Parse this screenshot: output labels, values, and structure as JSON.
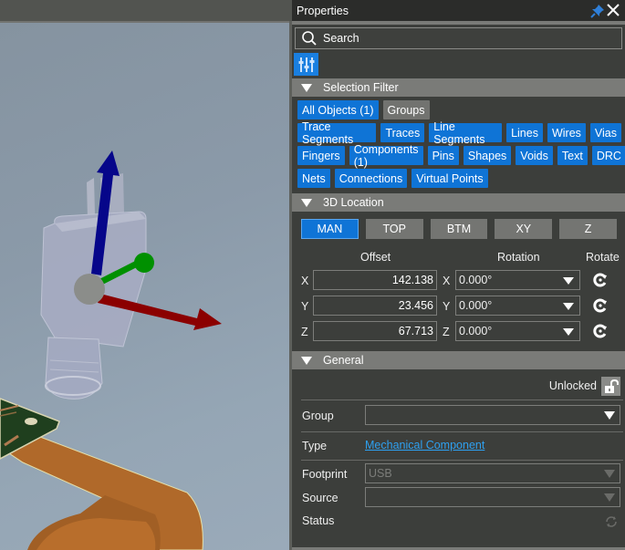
{
  "panel": {
    "title": "Properties",
    "search_placeholder": "Search",
    "icons": {
      "pin": "pin-icon",
      "close": "close-icon",
      "search": "search-icon",
      "filter": "sliders-icon"
    }
  },
  "selection_filter": {
    "header": "Selection Filter",
    "rows": [
      [
        {
          "label": "All Objects (1)",
          "active": true
        },
        {
          "label": "Groups",
          "active": false
        }
      ],
      [
        {
          "label": "Trace Segments",
          "active": true
        },
        {
          "label": "Traces",
          "active": true
        },
        {
          "label": "Line Segments",
          "active": true
        },
        {
          "label": "Lines",
          "active": true
        },
        {
          "label": "Wires",
          "active": true
        },
        {
          "label": "Vias",
          "active": true
        }
      ],
      [
        {
          "label": "Fingers",
          "active": true
        },
        {
          "label": "Components (1)",
          "active": true
        },
        {
          "label": "Pins",
          "active": true
        },
        {
          "label": "Shapes",
          "active": true
        },
        {
          "label": "Voids",
          "active": true
        },
        {
          "label": "Text",
          "active": true
        },
        {
          "label": "DRC",
          "active": true
        }
      ],
      [
        {
          "label": "Nets",
          "active": true
        },
        {
          "label": "Connections",
          "active": true
        },
        {
          "label": "Virtual Points",
          "active": true
        }
      ]
    ]
  },
  "location_3d": {
    "header": "3D Location",
    "view_buttons": [
      {
        "label": "MAN",
        "active": true
      },
      {
        "label": "TOP",
        "active": false
      },
      {
        "label": "BTM",
        "active": false
      },
      {
        "label": "XY",
        "active": false
      },
      {
        "label": "Z",
        "active": false
      }
    ],
    "col_offset": "Offset",
    "col_rotation": "Rotation",
    "col_rotate": "Rotate",
    "rows": [
      {
        "axis": "X",
        "offset": "142.138",
        "rotation": "0.000°"
      },
      {
        "axis": "Y",
        "offset": "23.456",
        "rotation": "0.000°"
      },
      {
        "axis": "Z",
        "offset": "67.713",
        "rotation": "0.000°"
      }
    ]
  },
  "general": {
    "header": "General",
    "lock_state": "Unlocked",
    "group_label": "Group",
    "group_value": "",
    "type_label": "Type",
    "type_value": "Mechanical Component",
    "footprint_label": "Footprint",
    "footprint_value": "USB",
    "source_label": "Source",
    "source_value": "",
    "status_label": "Status"
  },
  "colors": {
    "accent": "#0f74d6",
    "chip_inactive": "#727370",
    "panel_bg": "#3c3e3b",
    "section_header": "#7a7b78",
    "link": "#2ea0f0",
    "axis_x": "#8b0000",
    "axis_y": "#009000",
    "axis_z": "#00008b"
  }
}
